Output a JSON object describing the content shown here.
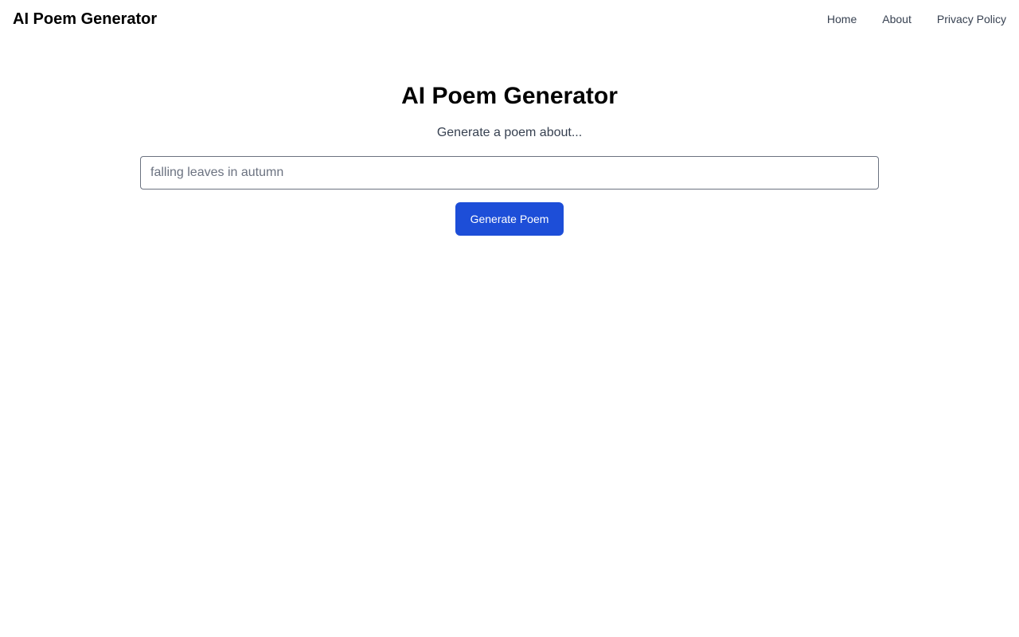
{
  "header": {
    "brand": "AI Poem Generator",
    "nav": [
      {
        "label": "Home"
      },
      {
        "label": "About"
      },
      {
        "label": "Privacy Policy"
      }
    ]
  },
  "main": {
    "title": "AI Poem Generator",
    "subtitle": "Generate a poem about...",
    "topic_input": {
      "value": "",
      "placeholder": "falling leaves in autumn"
    },
    "generate_label": "Generate Poem"
  },
  "colors": {
    "accent": "#1d4ed8",
    "nav_text": "#374151",
    "input_border": "#6b7280"
  }
}
